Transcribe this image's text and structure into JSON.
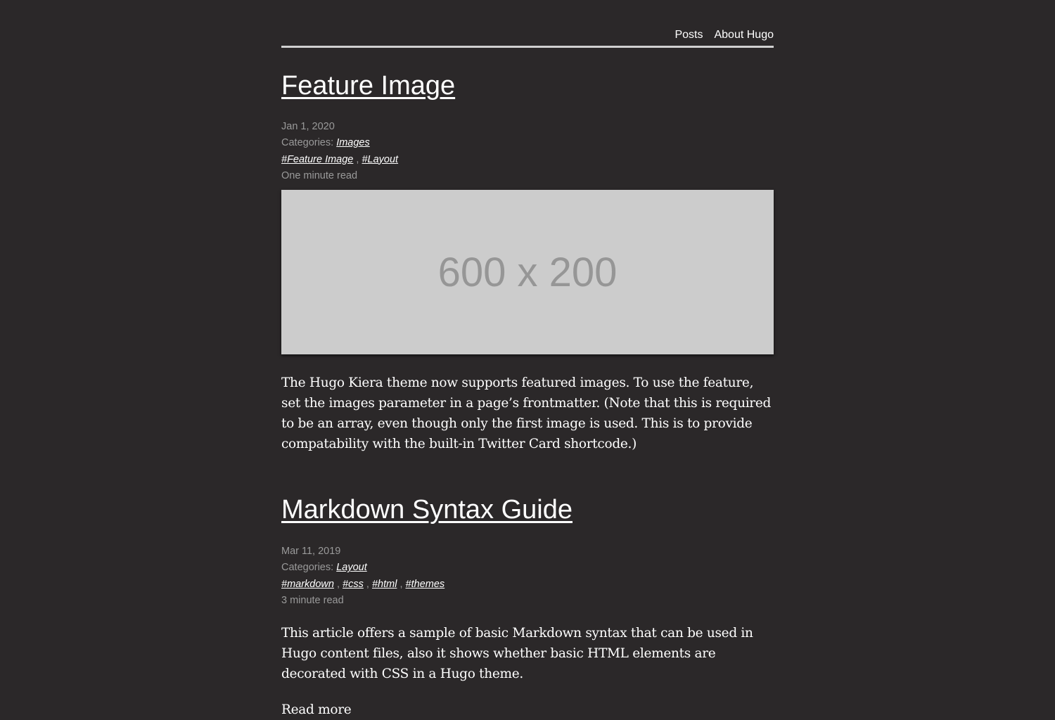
{
  "nav": {
    "items": [
      "Posts",
      "About Hugo"
    ]
  },
  "posts": [
    {
      "title": "Feature Image",
      "date": "Jan 1, 2020",
      "categories_label": "Categories:",
      "categories": [
        "Images"
      ],
      "tags": [
        "#Feature Image",
        "#Layout"
      ],
      "read_time": "One minute read",
      "image_text": "600 x 200",
      "summary": "The Hugo Kiera theme now supports featured images. To use the feature, set the images parameter in a page’s frontmatter. (Note that this is required to be an array, even though only the first image is used. This is to provide compatability with the built-in Twitter Card shortcode.)"
    },
    {
      "title": "Markdown Syntax Guide",
      "date": "Mar 11, 2019",
      "categories_label": "Categories:",
      "categories": [
        "Layout"
      ],
      "tags": [
        "#markdown",
        "#css",
        "#html",
        "#themes"
      ],
      "read_time": "3 minute read",
      "summary": "This article offers a sample of basic Markdown syntax that can be used in Hugo content files, also it shows whether basic HTML elements are decorated with CSS in a Hugo theme.",
      "read_more": "Read more"
    }
  ],
  "sep": ","
}
